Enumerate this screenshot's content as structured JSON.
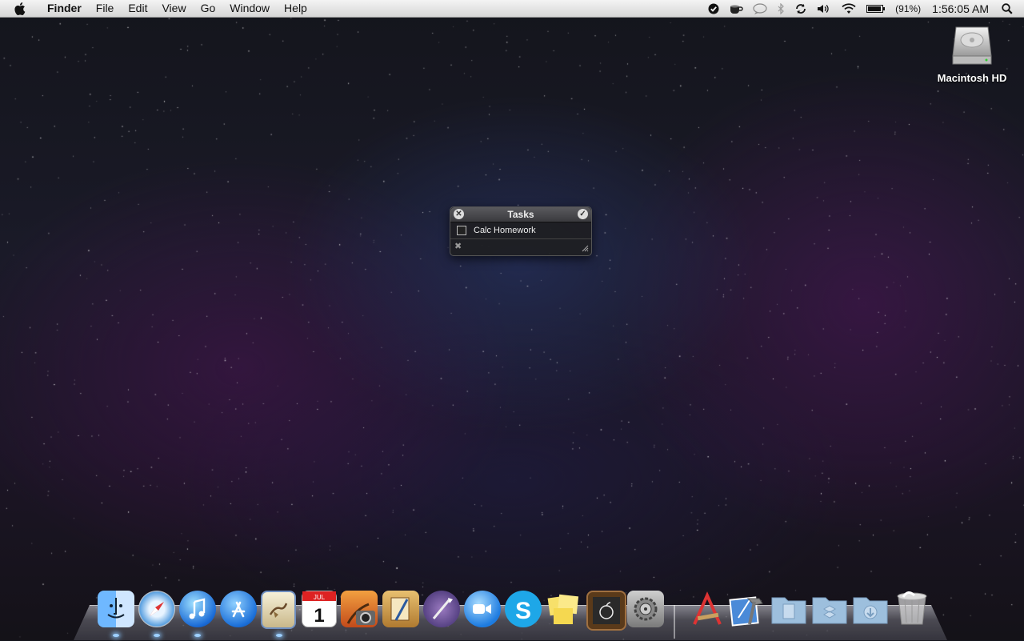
{
  "menubar": {
    "app": "Finder",
    "items": [
      "File",
      "Edit",
      "View",
      "Go",
      "Window",
      "Help"
    ],
    "battery": "(91%)",
    "clock": "1:56:05 AM"
  },
  "desktop": {
    "drive_label": "Macintosh HD"
  },
  "tasks_panel": {
    "title": "Tasks",
    "tasks": [
      {
        "label": "Calc Homework",
        "checked": false
      }
    ]
  },
  "dock": {
    "apps": [
      {
        "icon": "finder-icon",
        "running": true
      },
      {
        "icon": "safari-icon",
        "running": true
      },
      {
        "icon": "itunes-icon",
        "running": true
      },
      {
        "icon": "app-store-icon",
        "running": false
      },
      {
        "icon": "mail-icon",
        "running": true
      },
      {
        "icon": "ical-icon",
        "running": false
      },
      {
        "icon": "iphoto-icon",
        "running": false
      },
      {
        "icon": "preview-icon",
        "running": false
      },
      {
        "icon": "quill-app-icon",
        "running": false
      },
      {
        "icon": "facetime-icon",
        "running": false
      },
      {
        "icon": "skype-icon",
        "running": false
      },
      {
        "icon": "stickies-icon",
        "running": false
      },
      {
        "icon": "chalkboard-app-icon",
        "running": false
      },
      {
        "icon": "system-preferences-icon",
        "running": false
      },
      {
        "icon": "dev-tools-icon",
        "running": false
      },
      {
        "icon": "xcode-icon",
        "running": false
      }
    ],
    "folders": [
      {
        "icon": "documents-folder-icon"
      },
      {
        "icon": "dropbox-folder-icon"
      },
      {
        "icon": "downloads-folder-icon"
      },
      {
        "icon": "trash-icon"
      }
    ]
  }
}
